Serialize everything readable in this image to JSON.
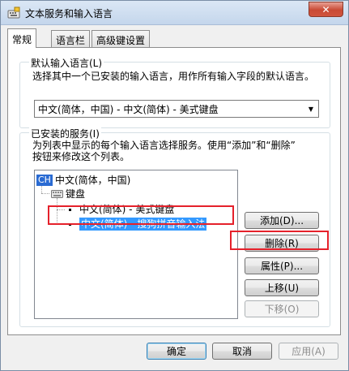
{
  "window": {
    "title": "文本服务和输入语言",
    "close_label": "✕"
  },
  "tabs": [
    {
      "label": "常规",
      "active": true
    },
    {
      "label": "语言栏",
      "active": false
    },
    {
      "label": "高级键设置",
      "active": false
    }
  ],
  "default_language": {
    "group_label": "默认输入语言(L)",
    "description": "选择其中一个已安装的输入语言，用作所有输入字段的默认语言。",
    "selected_value": "中文(简体，中国) - 中文(简体) - 美式键盘"
  },
  "installed_services": {
    "group_label": "已安装的服务(I)",
    "description_line1": "为列表中显示的每个输入语言选择服务。使用“添加”和“删除”",
    "description_line2": "按钮来修改这个列表。",
    "tree": {
      "language_badge": "CH",
      "language": "中文(简体，中国)",
      "category": "键盘",
      "items": [
        {
          "label": "中文(简体) - 美式键盘",
          "selected": false
        },
        {
          "label": "中文(简体) - 搜狗拼音输入法",
          "selected": true
        }
      ]
    },
    "buttons": {
      "add": "添加(D)...",
      "remove": "删除(R)",
      "properties": "属性(P)...",
      "move_up": "上移(U)",
      "move_down": "下移(O)"
    }
  },
  "footer": {
    "ok": "确定",
    "cancel": "取消",
    "apply": "应用(A)"
  },
  "colors": {
    "annotation_red": "#e5212b",
    "selection_blue": "#3399ff"
  }
}
